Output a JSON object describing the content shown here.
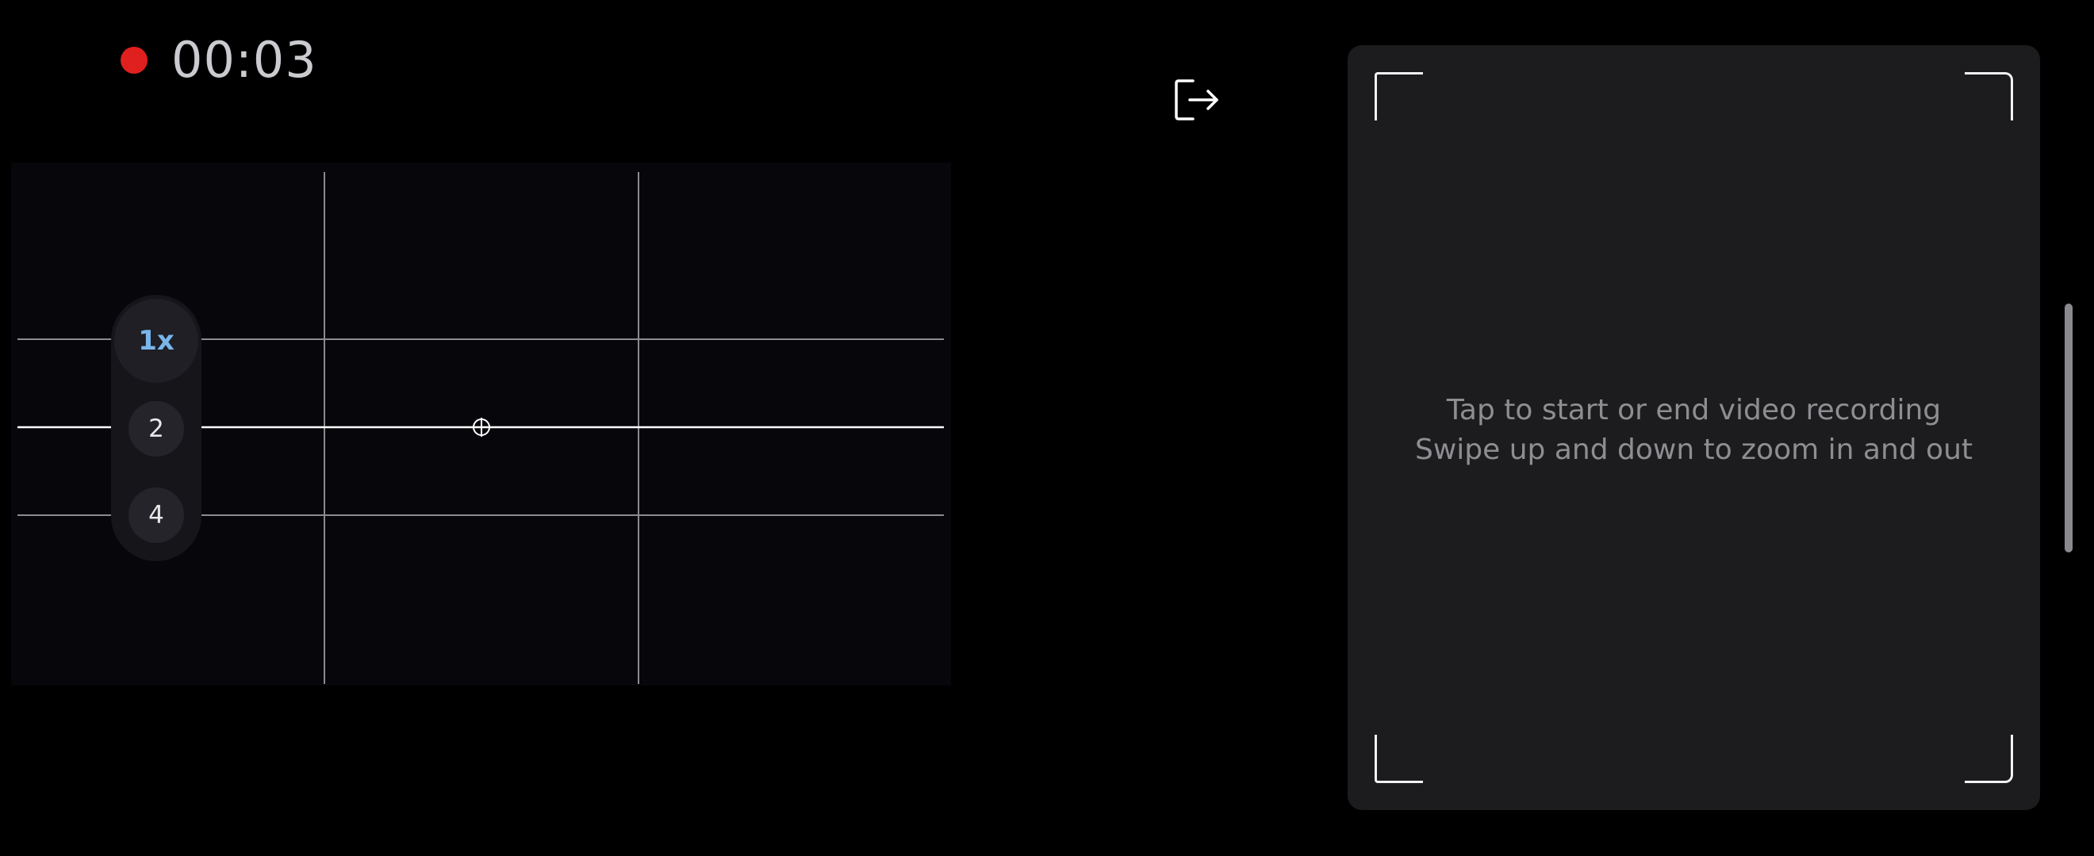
{
  "recording": {
    "indicator_color": "#e0201e",
    "elapsed_time": "00:03"
  },
  "viewfinder": {
    "grid": "3x3 thirds",
    "level_indicator": "crosshair-circle"
  },
  "zoom": {
    "options": [
      "1x",
      "2",
      "4"
    ],
    "selected": "1x",
    "selected_color": "#79b6ec"
  },
  "toolbar": {
    "exit_icon": "exit-icon"
  },
  "gesture_panel": {
    "line1": "Tap to start or end video recording",
    "line2": "Swipe up and down to zoom in and out"
  }
}
